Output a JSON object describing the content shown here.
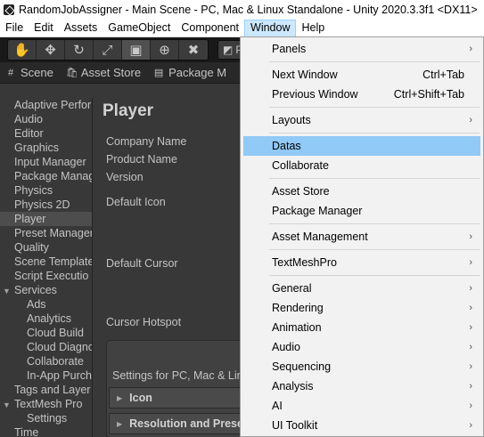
{
  "window": {
    "title": "RandomJobAssigner - Main Scene - PC, Mac & Linux Standalone - Unity 2020.3.3f1 <DX11>"
  },
  "menubar": {
    "items": [
      "File",
      "Edit",
      "Assets",
      "GameObject",
      "Component",
      "Window",
      "Help"
    ],
    "active": "Window"
  },
  "toolbar": {
    "tools": [
      "hand-tool",
      "move-tool",
      "rotate-tool",
      "scale-tool",
      "rect-tool",
      "transform-tool",
      "custom-tool"
    ],
    "tool_glyphs": [
      "✋",
      "✥",
      "↻",
      "⤢",
      "▣",
      "⊕",
      "✖"
    ],
    "pivot_label": "P"
  },
  "tabs": [
    {
      "icon": "#",
      "label": "Scene"
    },
    {
      "icon": "🛍",
      "label": "Asset Store"
    },
    {
      "icon": "▤",
      "label": "Package M"
    }
  ],
  "sidebar": {
    "items": [
      {
        "label": "Adaptive Perfor",
        "kind": "item"
      },
      {
        "label": "Audio",
        "kind": "item"
      },
      {
        "label": "Editor",
        "kind": "item"
      },
      {
        "label": "Graphics",
        "kind": "item"
      },
      {
        "label": "Input Manager",
        "kind": "item"
      },
      {
        "label": "Package Manag",
        "kind": "item"
      },
      {
        "label": "Physics",
        "kind": "item"
      },
      {
        "label": "Physics 2D",
        "kind": "item"
      },
      {
        "label": "Player",
        "kind": "selected"
      },
      {
        "label": "Preset Manager",
        "kind": "item"
      },
      {
        "label": "Quality",
        "kind": "item"
      },
      {
        "label": "Scene Template",
        "kind": "item"
      },
      {
        "label": "Script Executio",
        "kind": "item"
      },
      {
        "label": "Services",
        "kind": "group"
      },
      {
        "label": "Ads",
        "kind": "child"
      },
      {
        "label": "Analytics",
        "kind": "child"
      },
      {
        "label": "Cloud Build",
        "kind": "child"
      },
      {
        "label": "Cloud Diagno",
        "kind": "child"
      },
      {
        "label": "Collaborate",
        "kind": "child"
      },
      {
        "label": "In-App Purch",
        "kind": "child"
      },
      {
        "label": "Tags and Layer",
        "kind": "item"
      },
      {
        "label": "TextMesh Pro",
        "kind": "group"
      },
      {
        "label": "Settings",
        "kind": "child"
      },
      {
        "label": "Time",
        "kind": "item"
      }
    ]
  },
  "main": {
    "title": "Player",
    "company_label": "Company Name",
    "product_label": "Product Name",
    "version_label": "Version",
    "default_icon_label": "Default Icon",
    "default_cursor_label": "Default Cursor",
    "cursor_hotspot_label": "Cursor Hotspot",
    "settings_for": "Settings for PC, Mac & Lin",
    "icon_fold": "Icon",
    "resolution_fold": "Resolution and Prese"
  },
  "window_menu": {
    "items": [
      {
        "label": "Panels",
        "submenu": true
      },
      {
        "sep": true
      },
      {
        "label": "Next Window",
        "shortcut": "Ctrl+Tab"
      },
      {
        "label": "Previous Window",
        "shortcut": "Ctrl+Shift+Tab"
      },
      {
        "sep": true
      },
      {
        "label": "Layouts",
        "submenu": true
      },
      {
        "sep": true
      },
      {
        "label": "Datas",
        "highlighted": true
      },
      {
        "label": "Collaborate"
      },
      {
        "sep": true
      },
      {
        "label": "Asset Store"
      },
      {
        "label": "Package Manager"
      },
      {
        "sep": true
      },
      {
        "label": "Asset Management",
        "submenu": true
      },
      {
        "sep": true
      },
      {
        "label": "TextMeshPro",
        "submenu": true
      },
      {
        "sep": true
      },
      {
        "label": "General",
        "submenu": true
      },
      {
        "label": "Rendering",
        "submenu": true
      },
      {
        "label": "Animation",
        "submenu": true
      },
      {
        "label": "Audio",
        "submenu": true
      },
      {
        "label": "Sequencing",
        "submenu": true
      },
      {
        "label": "Analysis",
        "submenu": true
      },
      {
        "label": "AI",
        "submenu": true
      },
      {
        "label": "UI Toolkit",
        "submenu": true
      }
    ]
  }
}
